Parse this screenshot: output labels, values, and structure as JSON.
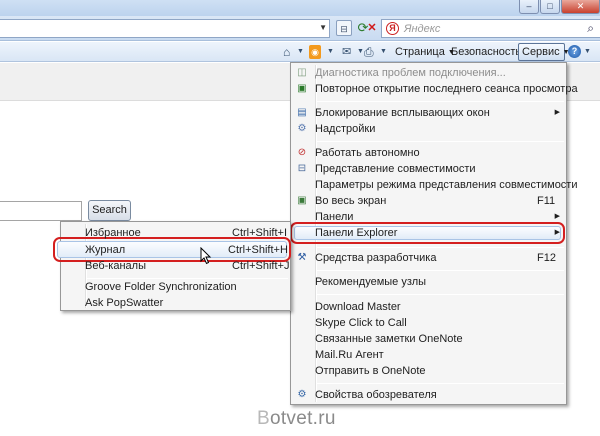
{
  "titlebar": {
    "minimize_label": "–",
    "maximize_label": "□",
    "close_label": "✕"
  },
  "address": {
    "search_placeholder": "Яндекс"
  },
  "command_bar": {
    "page_label": "Страница",
    "safety_label": "Безопасность",
    "tools_label": "Сервис",
    "help_label": "?"
  },
  "page": {
    "search_button_label": "Search"
  },
  "tools_menu": {
    "items": [
      {
        "label": "Диагностика проблем подключения...",
        "shortcut": "",
        "disabled": true
      },
      {
        "label": "Повторное открытие последнего сеанса просмотра",
        "shortcut": ""
      },
      {
        "label": "Блокирование всплывающих окон",
        "shortcut": "",
        "submenu": true
      },
      {
        "label": "Надстройки",
        "shortcut": ""
      },
      {
        "label": "Работать автономно",
        "shortcut": ""
      },
      {
        "label": "Представление совместимости",
        "shortcut": ""
      },
      {
        "label": "Параметры режима представления совместимости",
        "shortcut": ""
      },
      {
        "label": "Во весь экран",
        "shortcut": "F11"
      },
      {
        "label": "Панели",
        "shortcut": "",
        "submenu": true
      },
      {
        "label": "Панели Explorer",
        "shortcut": "",
        "submenu": true,
        "highlighted": true
      },
      {
        "label": "Средства разработчика",
        "shortcut": "F12"
      },
      {
        "label": "Рекомендуемые узлы",
        "shortcut": ""
      },
      {
        "label": "Download Master",
        "shortcut": ""
      },
      {
        "label": "Skype Click to Call",
        "shortcut": ""
      },
      {
        "label": "Связанные заметки OneNote",
        "shortcut": ""
      },
      {
        "label": "Mail.Ru Агент",
        "shortcut": ""
      },
      {
        "label": "Отправить в OneNote",
        "shortcut": ""
      },
      {
        "label": "Свойства обозревателя",
        "shortcut": ""
      }
    ]
  },
  "explorer_bars_menu": {
    "items": [
      {
        "label": "Избранное",
        "shortcut": "Ctrl+Shift+I"
      },
      {
        "label": "Журнал",
        "shortcut": "Ctrl+Shift+H",
        "highlighted": true
      },
      {
        "label": "Веб-каналы",
        "shortcut": "Ctrl+Shift+J"
      },
      {
        "label": "Groove Folder Synchronization",
        "shortcut": ""
      },
      {
        "label": "Ask PopSwatter",
        "shortcut": ""
      }
    ]
  },
  "watermark": {
    "first_letter": "B",
    "rest": "otvet.ru"
  },
  "colors": {
    "highlight_ring": "#d41f1f",
    "menu_background": "#f5f5f5",
    "toolbar_blue": "#d9e6f5"
  },
  "icons": [
    "rss-feed-icon",
    "home-icon",
    "print-icon",
    "mail-icon",
    "refresh-icon",
    "stop-icon",
    "compat-icon",
    "help-icon",
    "popup-icon",
    "addons-icon",
    "offline-icon",
    "fullscreen-icon",
    "devtools-icon",
    "options-icon"
  ]
}
